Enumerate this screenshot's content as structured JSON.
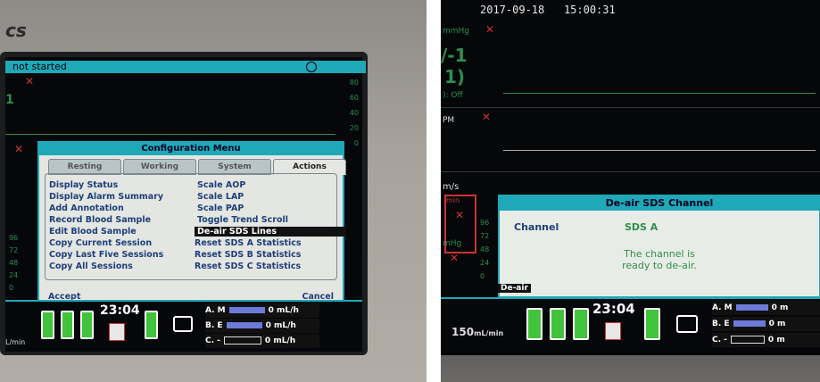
{
  "left_screen": {
    "brand": "cs",
    "status_text": "not started",
    "scale_ticks": [
      "80",
      "60",
      "40",
      "20",
      "0"
    ],
    "side_digits": [
      "1",
      "96",
      "72",
      "48",
      "24",
      "0"
    ],
    "menu": {
      "title": "Configuration Menu",
      "tabs": [
        {
          "label": "Resting",
          "active": false
        },
        {
          "label": "Working",
          "active": false
        },
        {
          "label": "System",
          "active": false
        },
        {
          "label": "Actions",
          "active": true
        }
      ],
      "left_items": [
        "Display Status",
        "Display Alarm Summary",
        "Add Annotation",
        "Record Blood Sample",
        "Edit Blood Sample",
        "Copy Current Session",
        "Copy Last Five Sessions",
        "Copy All Sessions"
      ],
      "right_items": [
        "Scale AOP",
        "Scale LAP",
        "Scale PAP",
        "Toggle Trend Scroll",
        "De-air SDS Lines",
        "Reset SDS A Statistics",
        "Reset SDS B Statistics",
        "Reset SDS C Statistics"
      ],
      "selected_item": "De-air SDS Lines",
      "accept": "Accept",
      "cancel": "Cancel"
    },
    "bottom": {
      "units": "L/min",
      "time": "23:04",
      "pumps": [
        {
          "label": "A. M",
          "value": "0",
          "unit": "mL/h"
        },
        {
          "label": "B. E",
          "value": "0",
          "unit": "mL/h"
        },
        {
          "label": "C. -",
          "value": "0",
          "unit": "mL/h"
        }
      ]
    }
  },
  "right_screen": {
    "datetime": "2017-09-18",
    "time": "15:00:31",
    "labels": {
      "mmhg_top": "mmHg",
      "big1": "/-1",
      "big2": "1)",
      "off": "): Off",
      "pm": "PM",
      "ms": "m/s",
      "min": "min",
      "mmhg": "mHg"
    },
    "ticks": [
      "96",
      "72",
      "48",
      "24",
      "0"
    ],
    "dialog": {
      "title": "De-air SDS Channel",
      "channel_label": "Channel",
      "channel_value": "SDS A",
      "message_line1": "The channel is",
      "message_line2": "ready to de-air.",
      "button": "De-air"
    },
    "bottom": {
      "flow": "150",
      "flow_unit": "mL/min",
      "time": "23:04",
      "pumps": [
        {
          "label": "A. M",
          "value": "0",
          "unit": "m"
        },
        {
          "label": "B. E",
          "value": "0",
          "unit": "m"
        },
        {
          "label": "C. -",
          "value": "0",
          "unit": "m"
        }
      ]
    }
  },
  "colors": {
    "accent_teal": "#1fa8b8",
    "waveform_green": "#2e8f4d",
    "alarm_red": "#cc3333",
    "menu_text_blue": "#1e3f7a",
    "battery_green": "#41c33b"
  },
  "icons": [
    "clock-icon",
    "alarm-off-icon",
    "battery-icon",
    "monitor-icon",
    "syringe-pump-icon"
  ]
}
